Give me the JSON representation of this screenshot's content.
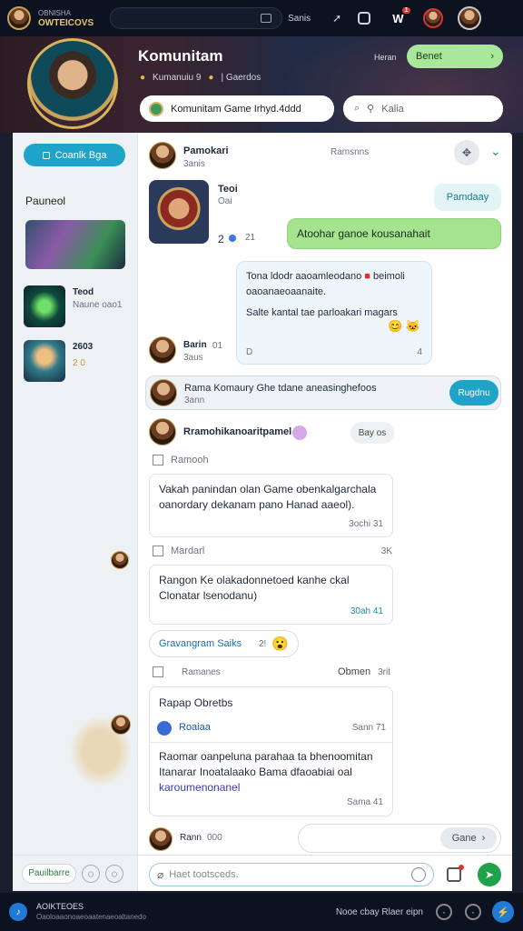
{
  "topbar": {
    "brand_line1": "OBNISHA",
    "brand_line2": "OWTEICOVS",
    "search_value": "",
    "nav_link": "Sanis",
    "notification_count": "1"
  },
  "header": {
    "title": "Komunitam",
    "meta_count": "Kumanuiu 9",
    "meta_label": "| Gaerdos",
    "menu_label": "Heran",
    "action_button": "Benet",
    "community_name": "Komunitam Game Irhyd.4ddd",
    "search_placeholder": "Kalia"
  },
  "sidebar": {
    "primary_button": "Coanlk Bga",
    "section_label": "Pauneol",
    "items": [
      {
        "title": "Teod",
        "subtitle": "Naune oao1"
      },
      {
        "title": "2603",
        "subtitle": "2 0"
      }
    ],
    "footer_button": "Pauilbarre"
  },
  "chat_header": {
    "name": "Pamokari",
    "status": "3anis",
    "members_label": "Ramsnns"
  },
  "messages": {
    "m1_name": "Teoi",
    "m1_sub": "Oai",
    "m1_count": "2",
    "m1_reply": "21",
    "reply_chip": "Pamdaay",
    "green_bubble": "Atoohar ganoe kousanahait",
    "blue_line1": "Tona ldodr aaoamleodano",
    "blue_line1b": "beimoli",
    "blue_line2": "oaoanaeoaanaite.",
    "blue_line3": "Salte kantal tae parloakari magars",
    "blue_footer_left": "D",
    "blue_footer_right": "4",
    "m2_name": "Barin",
    "m2_sub": "3aus",
    "m2_time": "01"
  },
  "banner": {
    "text": "Rama Komaury Ghe tdane aneasinghefoos",
    "sub": "3ann",
    "button": "Rugdnu"
  },
  "thread": {
    "title": "Rramohikanoaritpamel",
    "badge": "Bay os",
    "section1_label": "Ramooh",
    "card1_line1": "Vakah panindan olan Game obenkalgarchala",
    "card1_line2": "oanordary dekanam pano Hanad aaeol).",
    "card1_meta": "3ochi 31",
    "section2_label": "Mardarl",
    "section2_right": "3K",
    "card2_line1": "Rangon Ke olakadonnetoed kanhe ckal",
    "card2_line2": "Clonatar lsenodanu)",
    "card2_meta": "30ah 41",
    "chip": "Gravangram Saiks",
    "chip_count": "2!",
    "section3_label": "Ramanes",
    "section3_right": "Obmen",
    "section3_right2": "3rit",
    "card3_title": "Rapap Obretbs",
    "card3_user": "Roaiaa",
    "card3_user_time": "Sann 71",
    "card3_line1": "Raomar oanpeluna parahaa ta bhenoomitan",
    "card3_line2": "Itanarar Inoatalaako Bama dfaoabiai oal",
    "card3_line3": "karoumenonanel",
    "card3_meta": "Sama 41",
    "last_name": "Rann",
    "last_time": "000",
    "send_chip": "Gane"
  },
  "composer": {
    "placeholder": "Haet tootsceds."
  },
  "bottombar": {
    "line1": "AOIKTEOES",
    "line2": "Oaoloaaonoaeoaatenaeoaltanedo",
    "right_text": "Nooe cbay Rlaer eipn"
  },
  "colors": {
    "accent": "#1fa3c8",
    "green": "#9be38a",
    "panel_bg": "#ffffff"
  }
}
